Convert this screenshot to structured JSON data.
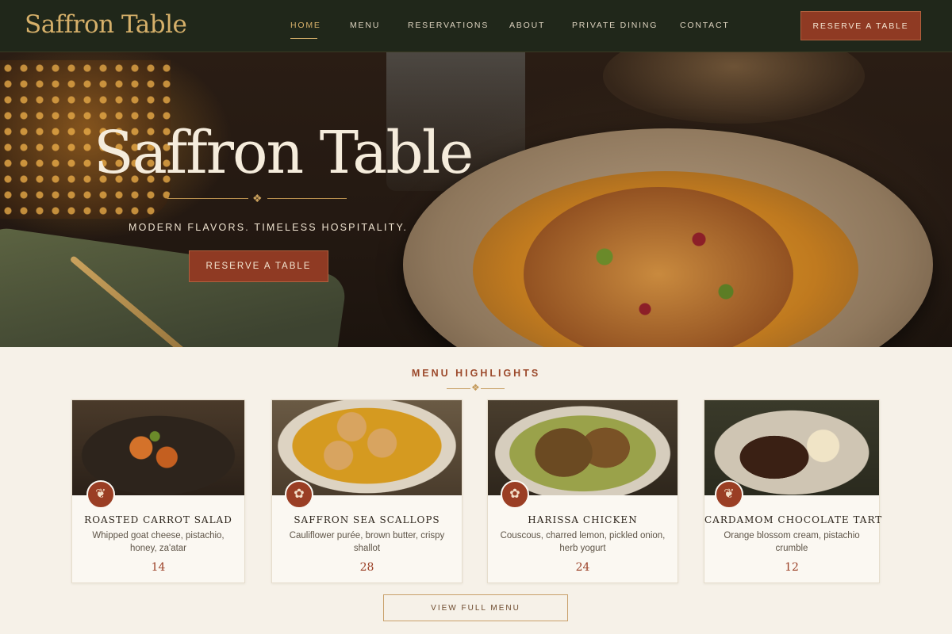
{
  "header": {
    "brand": "Saffron Table",
    "nav": [
      {
        "label": "HOME",
        "active": true
      },
      {
        "label": "MENU"
      },
      {
        "label": "RESERVATIONS"
      },
      {
        "label": "ABOUT"
      },
      {
        "label": "PRIVATE DINING"
      },
      {
        "label": "CONTACT"
      }
    ],
    "cta_label": "RESERVE A TABLE"
  },
  "hero": {
    "title": "Saffron Table",
    "ornament_icon": "diamond-flourish-icon",
    "tagline": "MODERN FLAVORS. TIMELESS HOSPITALITY.",
    "cta_label": "RESERVE A TABLE"
  },
  "highlights": {
    "title": "MENU HIGHLIGHTS",
    "items": [
      {
        "name": "ROASTED CARROT SALAD",
        "desc": "Whipped goat cheese, pistachio, honey, za'atar",
        "price": "14",
        "icon": "leaf-icon"
      },
      {
        "name": "SAFFRON SEA SCALLOPS",
        "desc": "Cauliflower purée, brown butter, crispy shallot",
        "price": "28",
        "icon": "flower-icon"
      },
      {
        "name": "HARISSA CHICKEN",
        "desc": "Couscous, charred lemon, pickled onion, herb yogurt",
        "price": "24",
        "icon": "flower-icon"
      },
      {
        "name": "CARDAMOM CHOCOLATE TART",
        "desc": "Orange blossom cream, pistachio crumble",
        "price": "12",
        "icon": "leaf-icon"
      }
    ],
    "view_menu_label": "VIEW FULL MENU"
  },
  "colors": {
    "header_bg": "#20271a",
    "accent_gold": "#d6b06a",
    "accent_red": "#8f3a23",
    "page_bg": "#f6f1e8"
  }
}
